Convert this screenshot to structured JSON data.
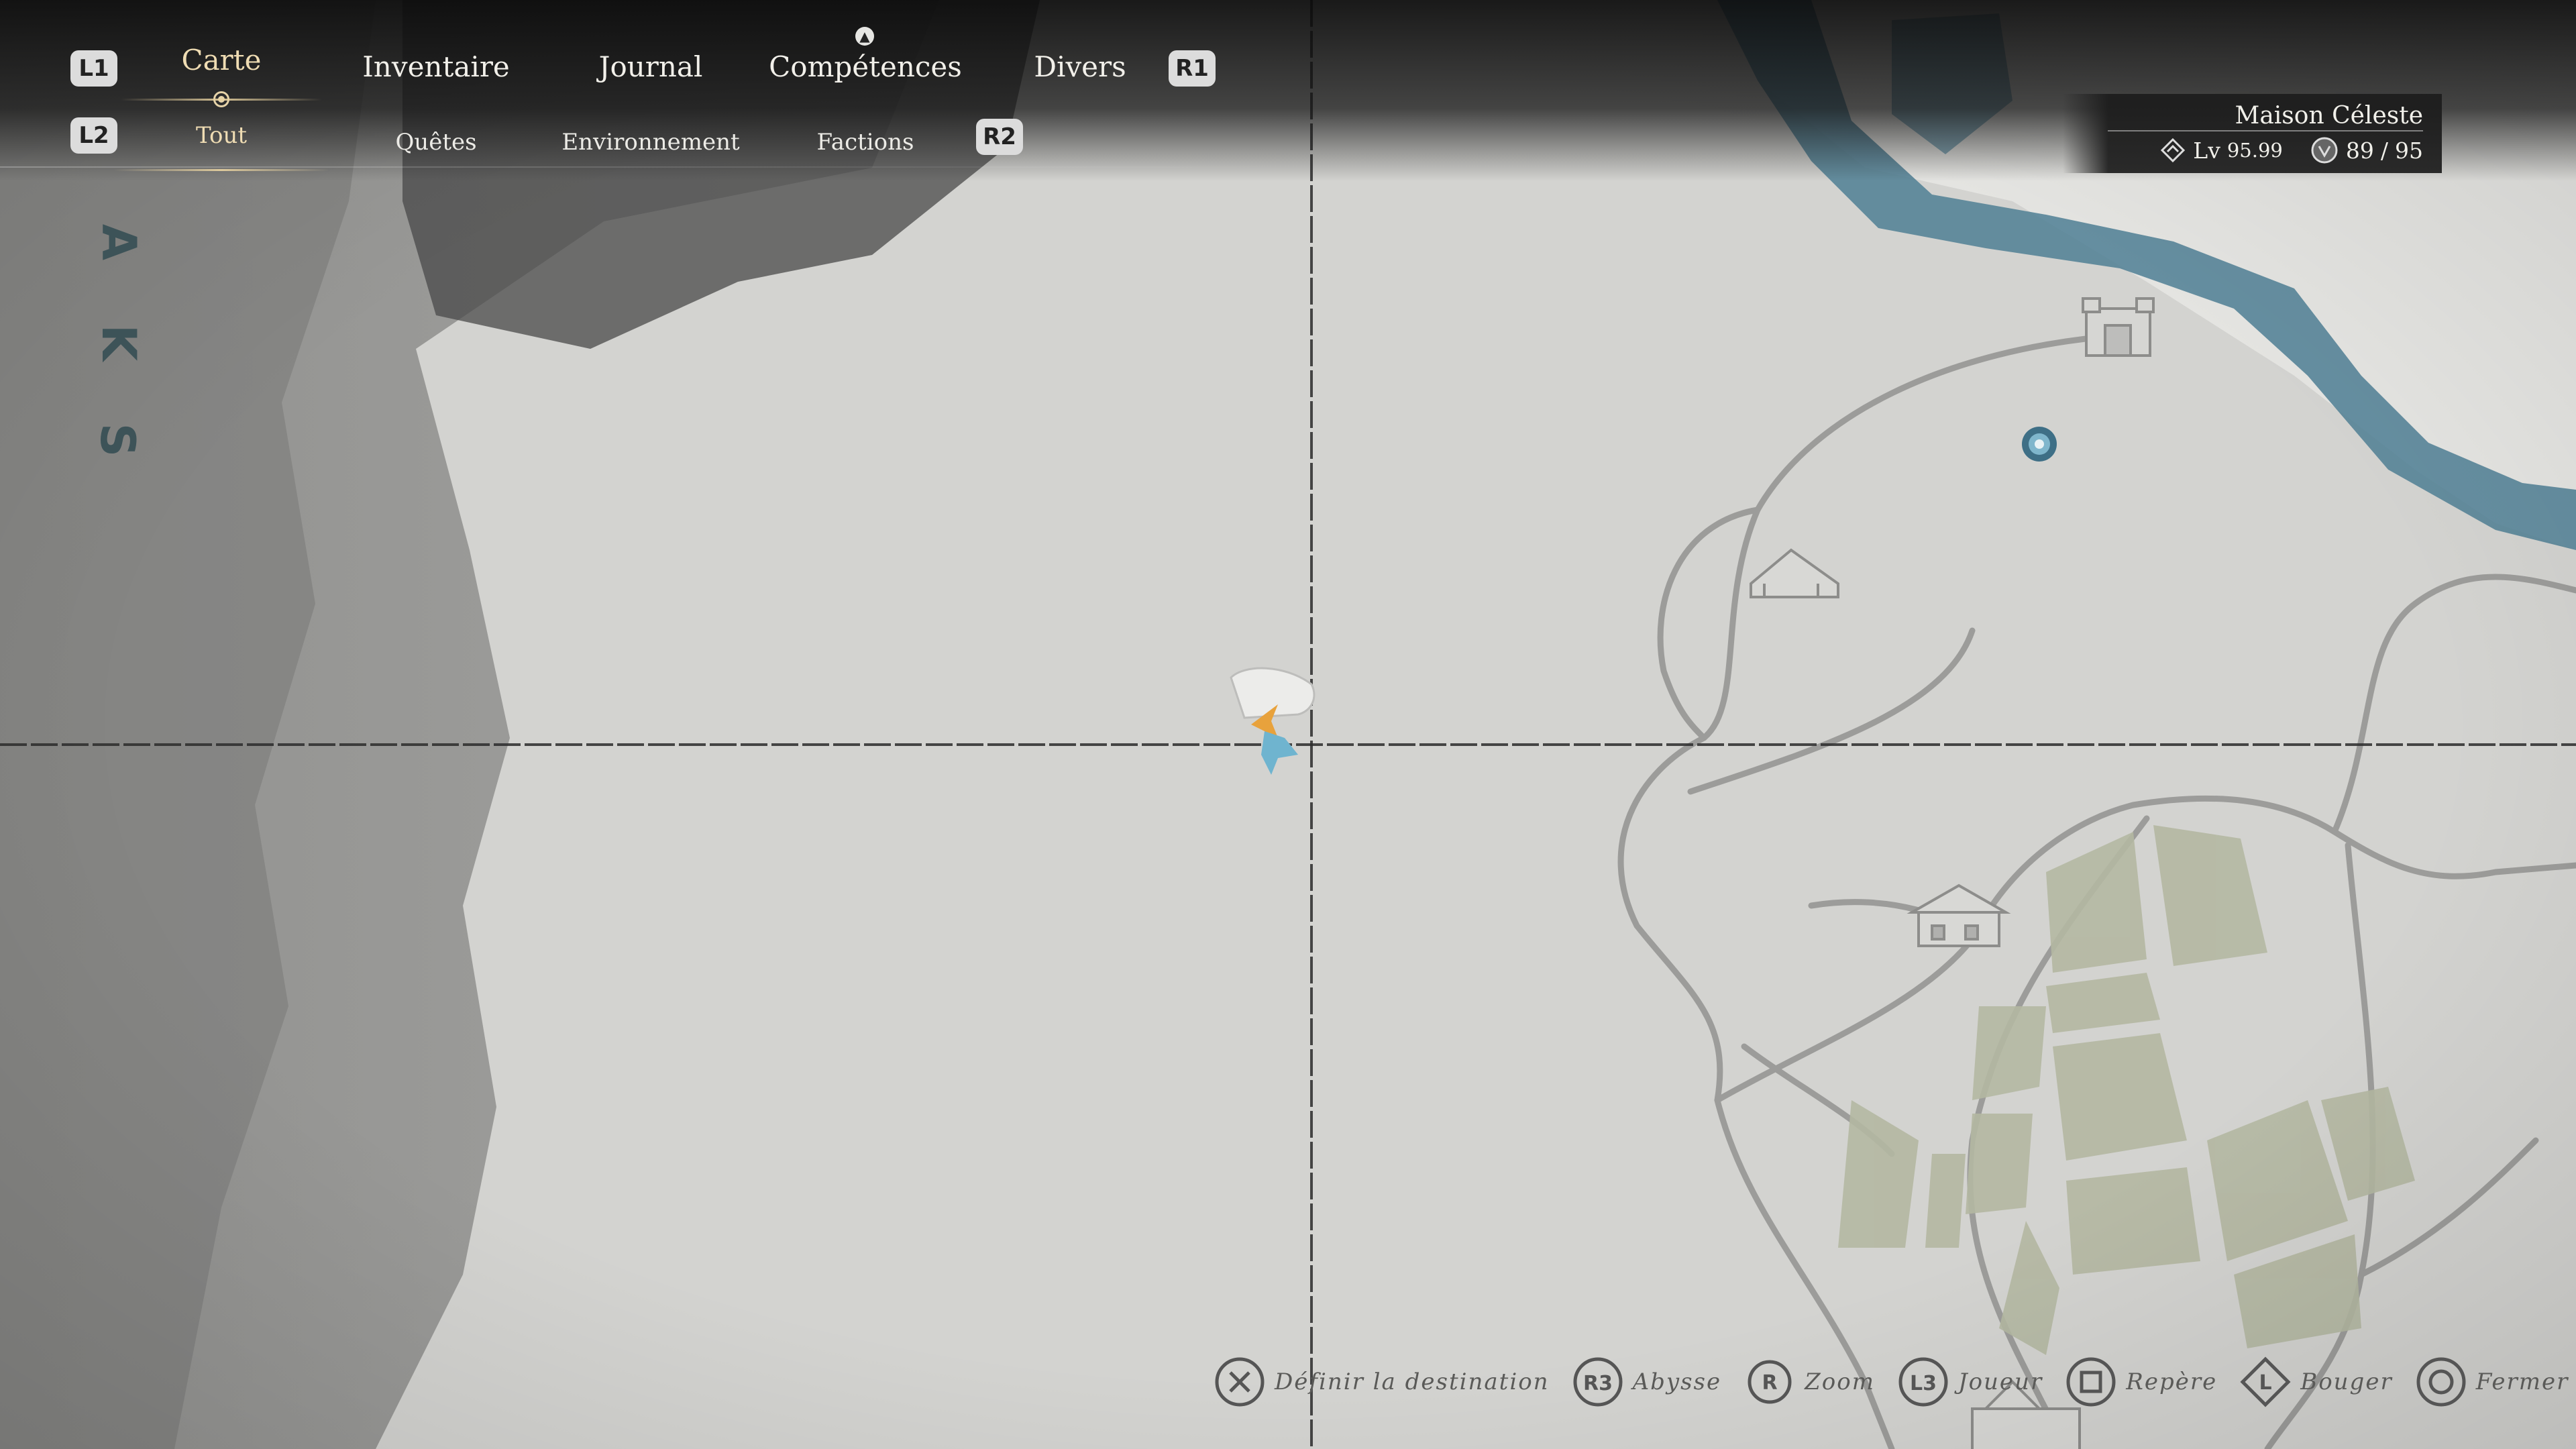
{
  "top_tabs": [
    {
      "label": "Carte",
      "active": true
    },
    {
      "label": "Inventaire",
      "active": false
    },
    {
      "label": "Journal",
      "active": false
    },
    {
      "label": "Compétences",
      "active": false
    },
    {
      "label": "Divers",
      "active": false
    }
  ],
  "sub_tabs": [
    {
      "label": "Tout",
      "active": true
    },
    {
      "label": "Quêtes",
      "active": false
    },
    {
      "label": "Environnement",
      "active": false
    },
    {
      "label": "Factions",
      "active": false
    }
  ],
  "buttons": {
    "prev_tab": "L1",
    "next_tab": "R1",
    "prev_sub": "L2",
    "next_sub": "R2"
  },
  "map_label_letters": [
    "A",
    "K",
    "S"
  ],
  "info": {
    "location": "Maison Céleste",
    "level_prefix": "Lv",
    "level_value": "95.99",
    "progress_current": "89",
    "progress_sep": "/",
    "progress_total": "95"
  },
  "prompts": [
    {
      "button": "✕",
      "icon": "cross-button-icon",
      "label": "Définir la destination"
    },
    {
      "button": "R3",
      "icon": "r3-button-icon",
      "label": "Abysse"
    },
    {
      "button": "R",
      "icon": "right-stick-icon",
      "label": "Zoom"
    },
    {
      "button": "L3",
      "icon": "l3-button-icon",
      "label": "Joueur"
    },
    {
      "button": "□",
      "icon": "square-button-icon",
      "label": "Repère"
    },
    {
      "button": "L",
      "icon": "left-stick-icon",
      "label": "Bouger"
    },
    {
      "button": "○",
      "icon": "circle-button-icon",
      "label": "Fermer"
    }
  ],
  "colors": {
    "parchment": "#cfcfcc",
    "fog": "#7d7d7d",
    "water": "#4f7f94",
    "fields": "#b4b8a2",
    "road": "#9c9c9a",
    "active_tab": "#efdcb3",
    "player_marker": "#e8a23c",
    "ally_marker": "#6fb4cf"
  }
}
